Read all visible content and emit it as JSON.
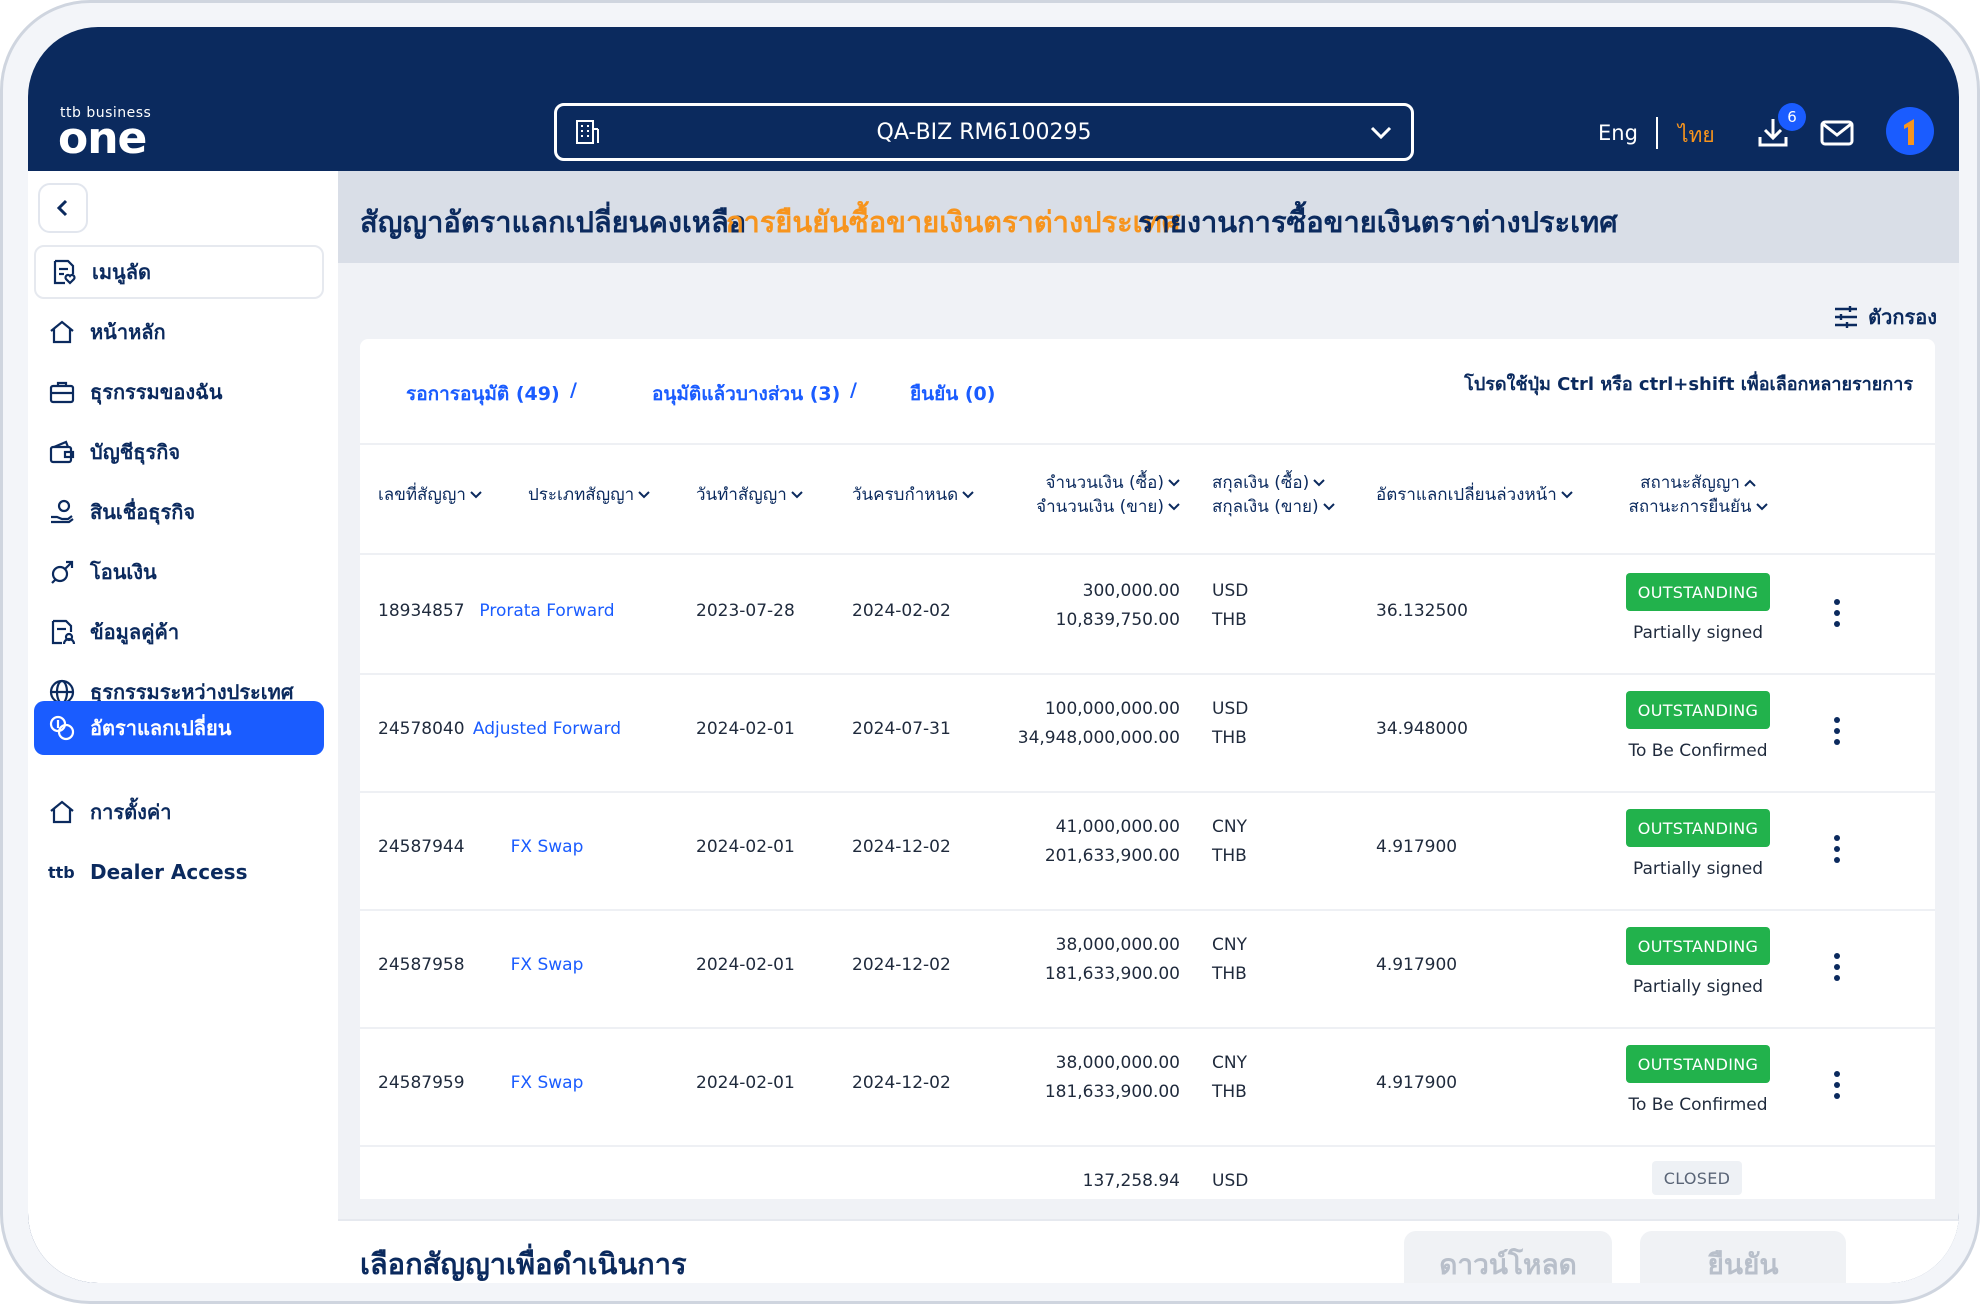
{
  "brand": {
    "small": "ttb business",
    "big": "one"
  },
  "header": {
    "account": "QA-BIZ RM6100295",
    "lang_eng": "Eng",
    "lang_thai": "ไทย",
    "download_count": "6"
  },
  "sidebar": {
    "items": [
      {
        "label": "เมนูลัด"
      },
      {
        "label": "หน้าหลัก"
      },
      {
        "label": "ธุรกรรมของฉัน"
      },
      {
        "label": "บัญชีธุรกิจ"
      },
      {
        "label": "สินเชื่อธุรกิจ"
      },
      {
        "label": "โอนเงิน"
      },
      {
        "label": "ข้อมูลคู่ค้า"
      },
      {
        "label": "ธุรกรรมระหว่างประเทศ"
      },
      {
        "label": "อัตราแลกเปลี่ยน"
      },
      {
        "label": "การตั้งค่า"
      },
      {
        "label": "Dealer Access",
        "prefix": "ttb"
      }
    ]
  },
  "tabs": [
    {
      "label": "สัญญาอัตราแลกเปลี่ยนคงเหลือ"
    },
    {
      "label": "การยืนยันซื้อขายเงินตราต่างประเทศ"
    },
    {
      "label": "รายงานการซื้อขายเงินตราต่างประเทศ"
    }
  ],
  "filter_label": "ตัวกรอง",
  "subtabs": [
    {
      "label": "รอการอนุมัติ (49)"
    },
    {
      "label": "อนุมัติแล้วบางส่วน (3)"
    },
    {
      "label": "ยืนยัน (0)"
    }
  ],
  "subtab_sep": "/",
  "hint": "โปรดใช้ปุ่ม Ctrl หรือ ctrl+shift เพื่อเลือกหลายรายการ",
  "columns": {
    "contract_no": "เลขที่สัญญา",
    "contract_type": "ประเภทสัญญา",
    "contract_date": "วันทำสัญญา",
    "due_date": "วันครบกำหนด",
    "amount_buy": "จำนวนเงิน (ซื้อ)",
    "amount_sell": "จำนวนเงิน (ขาย)",
    "ccy_buy": "สกุลเงิน (ซื้อ)",
    "ccy_sell": "สกุลเงิน (ขาย)",
    "forward_rate": "อัตราแลกเปลี่ยนล่วงหน้า",
    "contract_status": "สถานะสัญญา",
    "confirm_status": "สถานะการยืนยัน"
  },
  "rows": [
    {
      "no": "18934857",
      "type": "Prorata Forward",
      "date": "2023-07-28",
      "due": "2024-02-02",
      "buy": "300,000.00",
      "sell": "10,839,750.00",
      "ccy_buy": "USD",
      "ccy_sell": "THB",
      "rate": "36.132500",
      "status": "OUTSTANDING",
      "sign": "Partially signed"
    },
    {
      "no": "24578040",
      "type": "Adjusted Forward",
      "date": "2024-02-01",
      "due": "2024-07-31",
      "buy": "100,000,000.00",
      "sell": "34,948,000,000.00",
      "ccy_buy": "USD",
      "ccy_sell": "THB",
      "rate": "34.948000",
      "status": "OUTSTANDING",
      "sign": "To Be Confirmed"
    },
    {
      "no": "24587944",
      "type": "FX Swap",
      "date": "2024-02-01",
      "due": "2024-12-02",
      "buy": "41,000,000.00",
      "sell": "201,633,900.00",
      "ccy_buy": "CNY",
      "ccy_sell": "THB",
      "rate": "4.917900",
      "status": "OUTSTANDING",
      "sign": "Partially signed"
    },
    {
      "no": "24587958",
      "type": "FX Swap",
      "date": "2024-02-01",
      "due": "2024-12-02",
      "buy": "38,000,000.00",
      "sell": "181,633,900.00",
      "ccy_buy": "CNY",
      "ccy_sell": "THB",
      "rate": "4.917900",
      "status": "OUTSTANDING",
      "sign": "Partially signed"
    },
    {
      "no": "24587959",
      "type": "FX Swap",
      "date": "2024-02-01",
      "due": "2024-12-02",
      "buy": "38,000,000.00",
      "sell": "181,633,900.00",
      "ccy_buy": "CNY",
      "ccy_sell": "THB",
      "rate": "4.917900",
      "status": "OUTSTANDING",
      "sign": "To Be Confirmed"
    }
  ],
  "partial_row": {
    "buy": "137,258.94",
    "ccy_buy": "USD",
    "status": "CLOSED"
  },
  "footer": {
    "title": "เลือกสัญญาเพื่อดำเนินการ",
    "download_label": "ดาวน์โหลด",
    "confirm_label": "ยืนยัน"
  },
  "colors": {
    "navy": "#0b2a5e",
    "accent": "#1a5cff",
    "orange": "#f7941d",
    "status_green": "#22b24c"
  }
}
